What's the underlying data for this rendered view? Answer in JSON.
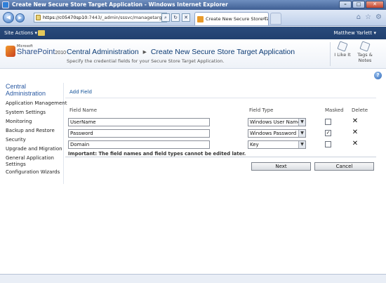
{
  "window": {
    "title": "Create New Secure Store Target Application - Windows Internet Explorer",
    "minimize_glyph": "–",
    "maximize_glyph": "□",
    "close_glyph": "✕"
  },
  "browser": {
    "back_glyph": "◀",
    "forward_glyph": "▶",
    "address_host": "https://c05470sp10",
    "address_path": ":7443/_admin/sssvc/managetargetappl",
    "search_glyph": "⌕",
    "refresh_glyph": "↻",
    "stop_glyph": "✕",
    "tab_title": "Create New Secure Store Ta...",
    "tab_close_glyph": "✕",
    "home_glyph": "⌂",
    "favorites_glyph": "☆",
    "tools_glyph": "⚙"
  },
  "ribbon": {
    "site_actions": "Site Actions ▾",
    "user_name": "Matthew Yarlett ▾"
  },
  "header": {
    "logo_microsoft": "Microsoft",
    "logo_sharepoint": "SharePoint",
    "logo_year": "2010",
    "breadcrumb_root": "Central Administration",
    "breadcrumb_sep": "▸",
    "breadcrumb_current": "Create New Secure Store Target Application",
    "subtitle": "Specify the credential fields for your Secure Store Target Application.",
    "like_label": "I Like It",
    "tags_label_1": "Tags &",
    "tags_label_2": "Notes",
    "help_glyph": "?"
  },
  "leftnav": {
    "heading_line1": "Central",
    "heading_line2": "Administration",
    "items": [
      "Application Management",
      "System Settings",
      "Monitoring",
      "Backup and Restore",
      "Security",
      "Upgrade and Migration",
      "General Application Settings",
      "Configuration Wizards"
    ]
  },
  "form": {
    "add_field": "Add Field",
    "headers": {
      "field_name": "Field Name",
      "field_type": "Field Type",
      "masked": "Masked",
      "delete": "Delete"
    },
    "rows": [
      {
        "name": "UserName",
        "type": "Windows User Name",
        "masked": "",
        "delete_glyph": "✕"
      },
      {
        "name": "Password",
        "type": "Windows Password",
        "masked": "✓",
        "delete_glyph": "✕"
      },
      {
        "name": "Domain",
        "type": "Key",
        "masked": "",
        "delete_glyph": "✕"
      }
    ],
    "dropdown_glyph": "▼",
    "note": "Important: The field names and field types cannot be edited later.",
    "next_button": "Next",
    "cancel_button": "Cancel"
  }
}
